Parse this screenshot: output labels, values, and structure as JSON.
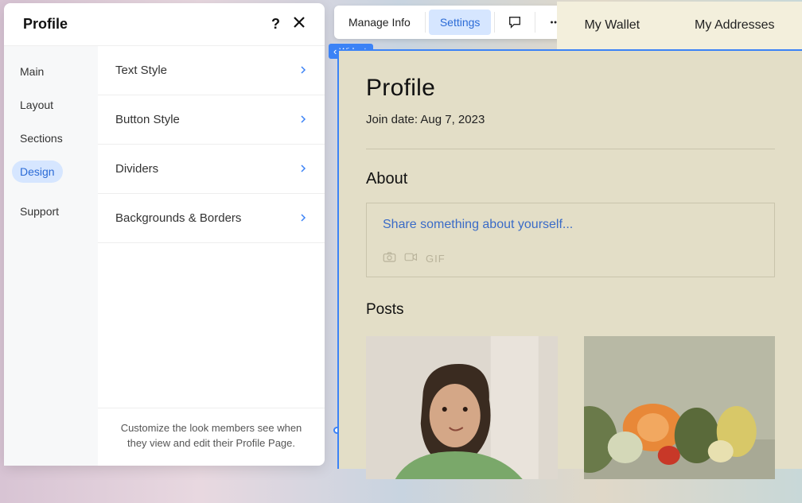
{
  "panel": {
    "title": "Profile",
    "nav": {
      "items": [
        {
          "label": "Main",
          "id": "main"
        },
        {
          "label": "Layout",
          "id": "layout"
        },
        {
          "label": "Sections",
          "id": "sections"
        },
        {
          "label": "Design",
          "id": "design"
        },
        {
          "label": "Support",
          "id": "support"
        }
      ],
      "active": "design"
    },
    "design_items": [
      {
        "label": "Text Style"
      },
      {
        "label": "Button Style"
      },
      {
        "label": "Dividers"
      },
      {
        "label": "Backgrounds & Borders"
      }
    ],
    "footer": "Customize the look members see when they view and edit their Profile Page."
  },
  "toolbar": {
    "manage_info": "Manage Info",
    "settings": "Settings"
  },
  "tabs": {
    "wallet": "My Wallet",
    "addresses": "My Addresses"
  },
  "widget_tag": "Widget",
  "preview": {
    "title": "Profile",
    "join_label": "Join date: Aug 7, 2023",
    "about_heading": "About",
    "about_placeholder": "Share something about yourself...",
    "gif_label": "GIF",
    "posts_heading": "Posts"
  }
}
